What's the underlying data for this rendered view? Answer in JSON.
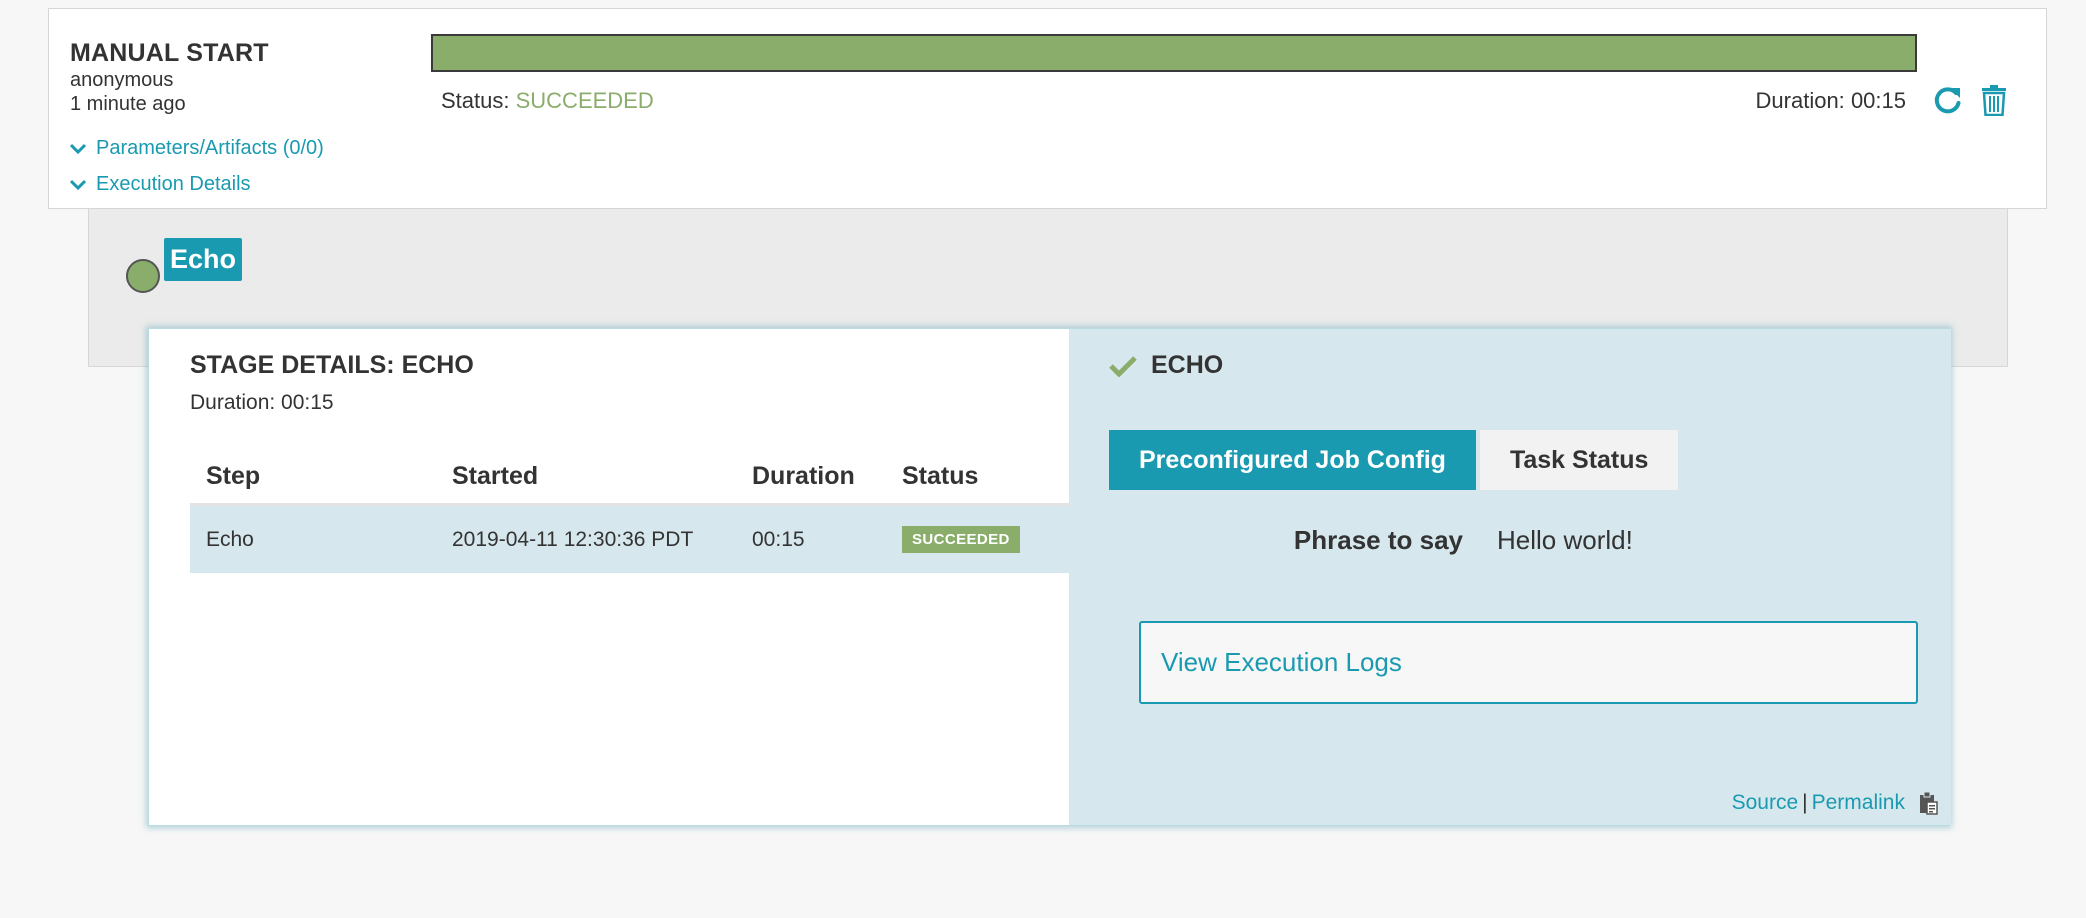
{
  "execution": {
    "trigger_title": "MANUAL START",
    "user": "anonymous",
    "time_ago": "1 minute ago",
    "params_link": "Parameters/Artifacts (0/0)",
    "details_link": "Execution Details",
    "status_label": "Status:",
    "status_value": "SUCCEEDED",
    "duration_label": "Duration:",
    "duration_value": "00:15",
    "progress": 1.0,
    "icons": [
      "chevron-down-icon",
      "restart-icon",
      "trash-icon"
    ]
  },
  "graph": {
    "stage_label": "Echo"
  },
  "stage_details": {
    "title": "STAGE DETAILS: ECHO",
    "duration": "Duration: 00:15",
    "columns": [
      "Step",
      "Started",
      "Duration",
      "Status"
    ],
    "rows": [
      {
        "step": "Echo",
        "started": "2019-04-11 12:30:36 PDT",
        "duration": "00:15",
        "status": "SUCCEEDED"
      }
    ]
  },
  "task_panel": {
    "name": "ECHO",
    "tabs": [
      "Preconfigured Job Config",
      "Task Status"
    ],
    "active_tab": "Preconfigured Job Config",
    "field_label": "Phrase to say",
    "field_value": "Hello world!",
    "logs_button": "View Execution Logs",
    "source_link": "Source",
    "separator": "|",
    "permalink_link": "Permalink",
    "icons": [
      "check-icon",
      "clipboard-icon"
    ]
  },
  "colors": {
    "accent": "#1a9ab0",
    "success": "#8aad6b",
    "panel_bg": "#d6e8ed"
  }
}
